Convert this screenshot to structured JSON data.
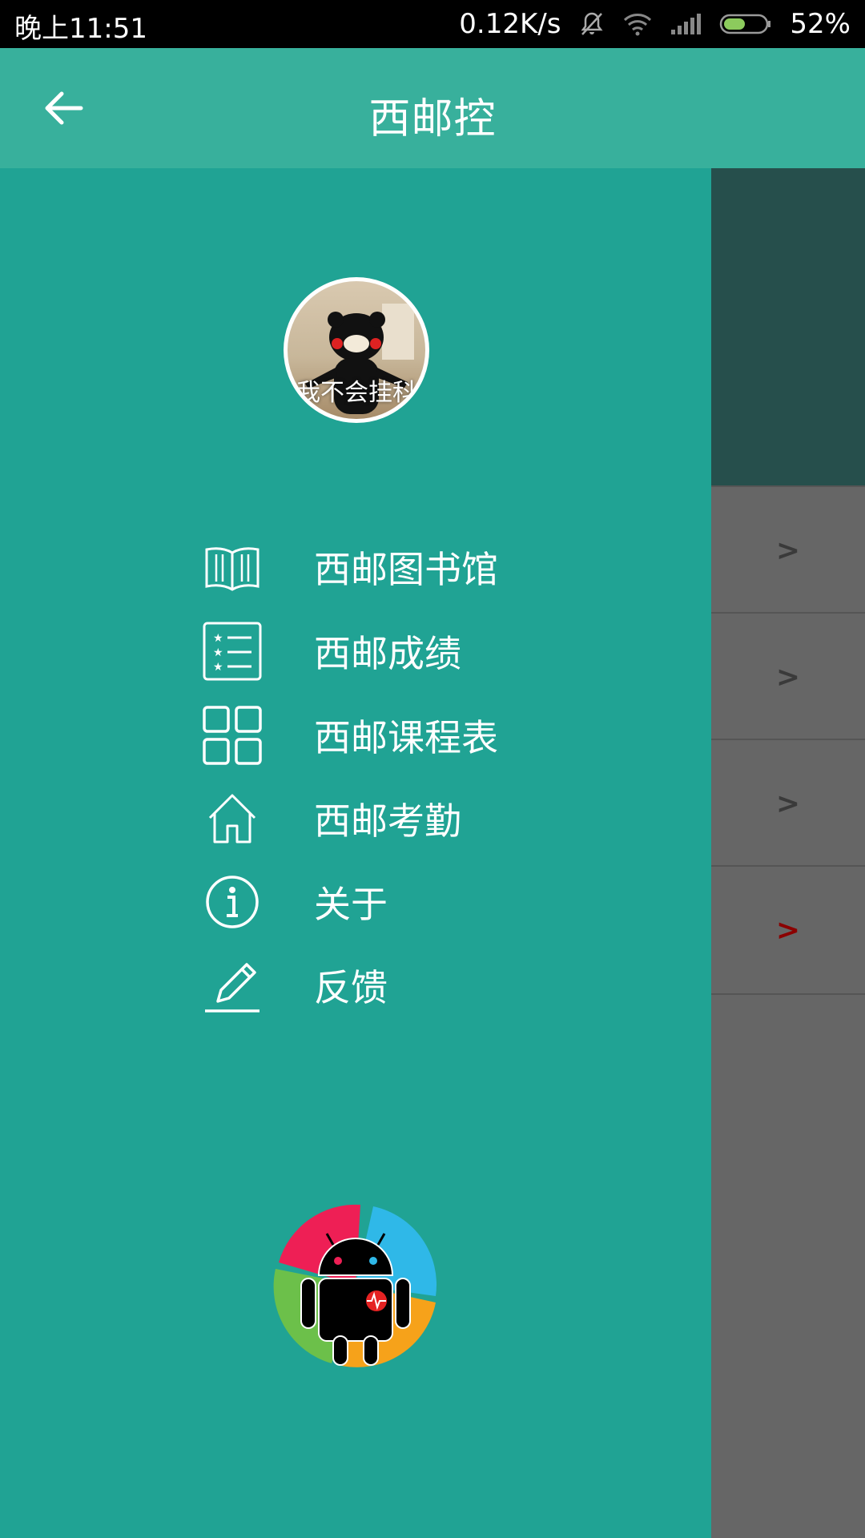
{
  "status_bar": {
    "time": "晚上11:51",
    "net_speed": "0.12K/s",
    "battery": "52%",
    "battery_level": 0.52,
    "icons": [
      "mute-icon",
      "wifi-icon",
      "signal-icon",
      "battery-icon"
    ]
  },
  "app_bar": {
    "title": "西邮控",
    "back_icon": "arrow-left-icon"
  },
  "drawer": {
    "avatar_caption": "我不会挂科",
    "menu": [
      {
        "label": "西邮图书馆",
        "icon": "book-icon"
      },
      {
        "label": "西邮成绩",
        "icon": "list-icon"
      },
      {
        "label": "西邮课程表",
        "icon": "grid-icon"
      },
      {
        "label": "西邮考勤",
        "icon": "home-icon"
      },
      {
        "label": "关于",
        "icon": "info-icon"
      },
      {
        "label": "反馈",
        "icon": "pencil-icon"
      }
    ],
    "bottom_logo": "android-logo-icon"
  },
  "background_rows": [
    {
      "chevron": ">"
    },
    {
      "chevron": ">"
    },
    {
      "chevron": ">"
    },
    {
      "chevron": ">"
    }
  ],
  "colors": {
    "app_bar": "#38B09C",
    "drawer": "#20A394",
    "overlay": "#666666",
    "accent_red": "#8B0000"
  }
}
